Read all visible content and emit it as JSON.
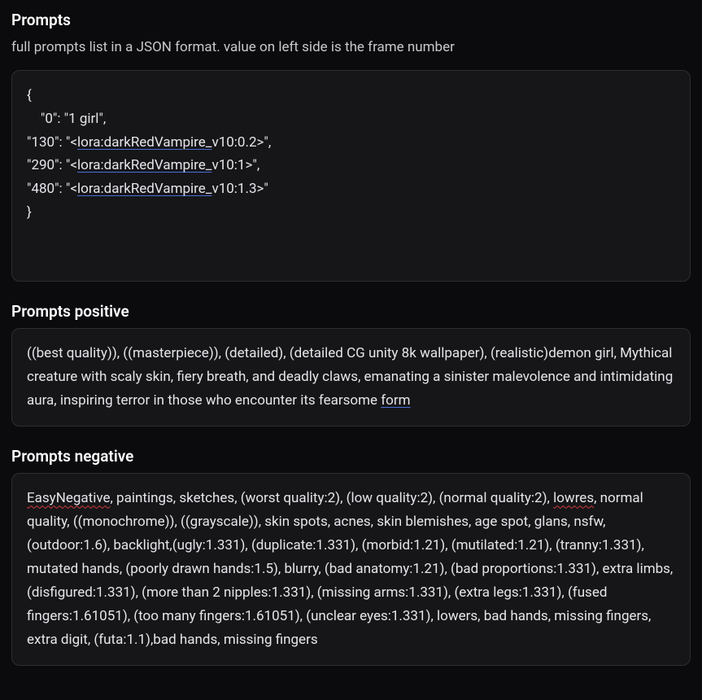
{
  "sections": {
    "prompts": {
      "title": "Prompts",
      "desc": "full prompts list in a JSON format. value on left side is the frame number",
      "json_lines": [
        "{",
        "    \"0\": \"1 girl\",",
        "\"130\": \"<",
        "lora:darkRedVampire_",
        "v10:0.2>\",",
        "\"290\": \"<",
        "lora:darkRedVampire_",
        "v10:1>\",",
        "\"480\": \"<",
        "lora:darkRedVampire_",
        "v10:1.3>\"",
        "}"
      ]
    },
    "positive": {
      "title": "Prompts positive",
      "text_plain": "((best quality)), ((masterpiece)), (detailed), (detailed CG unity 8k wallpaper), (realistic)demon girl, Mythical creature with scaly skin, fiery breath, and deadly claws, emanating a sinister malevolence and intimidating aura, inspiring terror in those who encounter its fearsome ",
      "text_underlined": "form"
    },
    "negative": {
      "title": "Prompts negative",
      "text_underlined1": "EasyNegative",
      "text_mid": ", paintings, sketches, (worst quality:2), (low quality:2), (normal quality:2), ",
      "text_underlined2": "lowres",
      "text_rest": ", normal quality, ((monochrome)), ((grayscale)), skin spots, acnes, skin blemishes, age spot, glans, nsfw, (outdoor:1.6), backlight,(ugly:1.331), (duplicate:1.331), (morbid:1.21), (mutilated:1.21), (tranny:1.331), mutated hands, (poorly drawn hands:1.5), blurry, (bad anatomy:1.21), (bad proportions:1.331), extra limbs, (disfigured:1.331), (more than 2 nipples:1.331), (missing arms:1.331), (extra legs:1.331), (fused fingers:1.61051), (too many fingers:1.61051), (unclear eyes:1.331), lowers, bad hands, missing fingers, extra digit, (futa:1.1),bad hands, missing fingers"
    }
  }
}
